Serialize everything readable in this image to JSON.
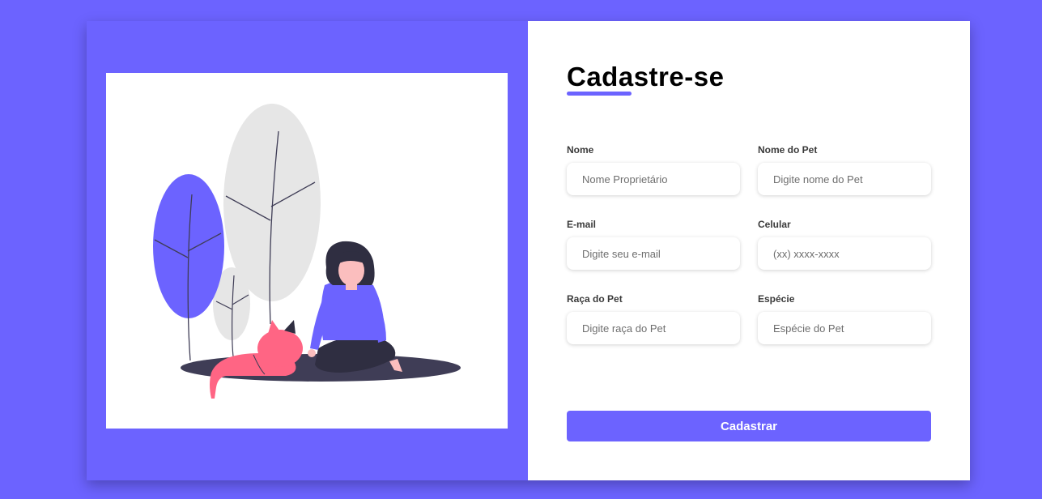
{
  "form": {
    "title": "Cadastre-se",
    "fields": [
      {
        "label": "Nome",
        "placeholder": "Nome Proprietário",
        "value": ""
      },
      {
        "label": "Nome do Pet",
        "placeholder": "Digite nome do Pet",
        "value": ""
      },
      {
        "label": "E-mail",
        "placeholder": "Digite seu e-mail",
        "value": ""
      },
      {
        "label": "Celular",
        "placeholder": "(xx) xxxx-xxxx",
        "value": ""
      },
      {
        "label": "Raça do Pet",
        "placeholder": "Digite raça do Pet",
        "value": ""
      },
      {
        "label": "Espécie",
        "placeholder": "Espécie do Pet",
        "value": ""
      }
    ],
    "submit_label": "Cadastrar"
  },
  "illustration": {
    "icon": "woman-with-cat-illustration"
  },
  "colors": {
    "background": "#6c63ff",
    "accent": "#6c63ff",
    "card": "#ffffff",
    "cat": "#ff6584",
    "foliage": "#e6e6e6",
    "shadow": "#3f3d56"
  }
}
